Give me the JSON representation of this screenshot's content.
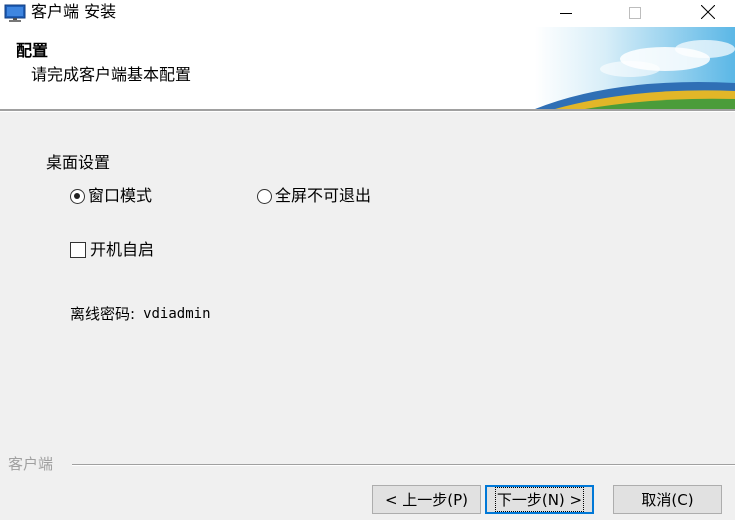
{
  "window": {
    "title": "客户端 安装",
    "controls": [
      "minimize-icon",
      "maximize-icon",
      "close-icon"
    ]
  },
  "header": {
    "title": "配置",
    "subtitle": "请完成客户端基本配置"
  },
  "desktop_settings": {
    "label": "桌面设置",
    "options": [
      {
        "label": "窗口模式",
        "selected": true
      },
      {
        "label": "全屏不可退出",
        "selected": false
      }
    ]
  },
  "autostart": {
    "label": "开机自启",
    "checked": false
  },
  "password": {
    "label": "离线密码:",
    "value": "vdiadmin"
  },
  "footer": {
    "brand": "客户端",
    "back_label": "< 上一步(P)",
    "next_label": "下一步(N) >",
    "cancel_label": "取消(C)"
  },
  "colors": {
    "background": "#f0f0f0",
    "header_background": "#ffffff",
    "accent": "#0078d7"
  }
}
